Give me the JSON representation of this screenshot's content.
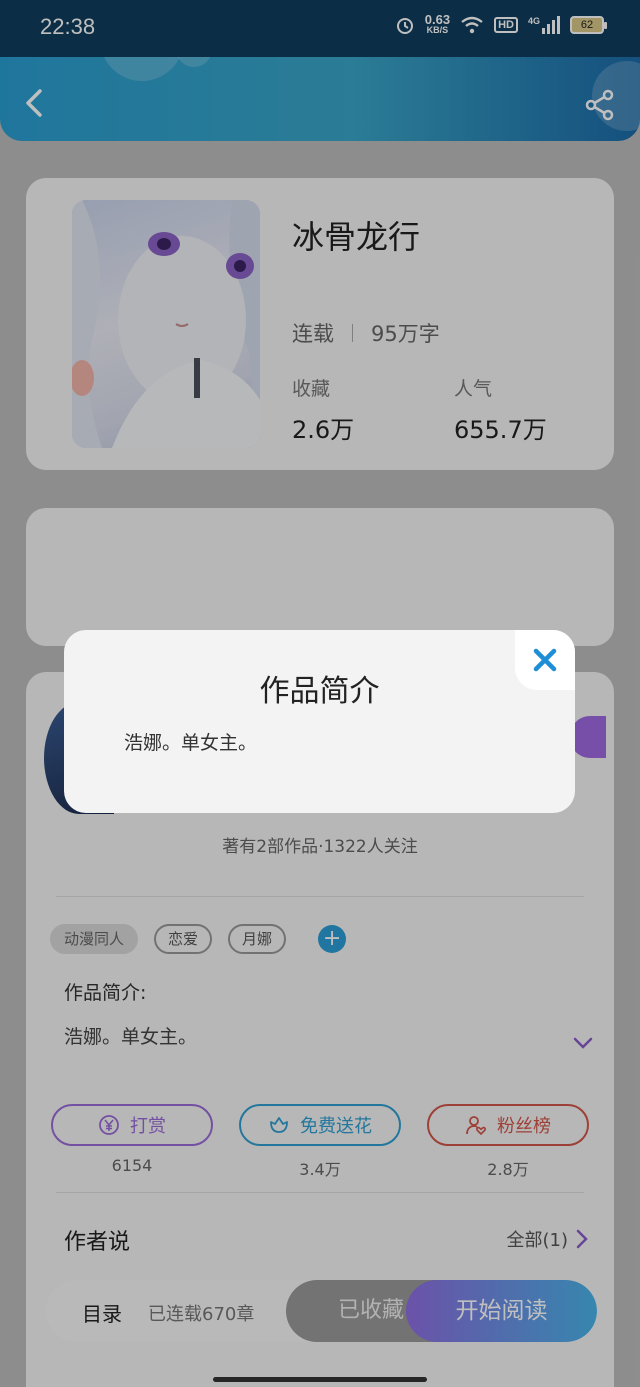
{
  "status_bar": {
    "time": "22:38",
    "net_speed": "0.63",
    "net_unit": "KB/S",
    "hd": "HD",
    "signal": "4G",
    "battery": "62"
  },
  "book": {
    "title": "冰骨龙行",
    "status": "连载",
    "word_count": "95万字",
    "favorites_label": "收藏",
    "favorites_value": "2.6万",
    "popularity_label": "人气",
    "popularity_value": "655.7万"
  },
  "author": {
    "meta": "著有2部作品·1322人关注"
  },
  "tags": [
    "动漫同人",
    "恋爱",
    "月娜"
  ],
  "add_tag_label": "+",
  "intro": {
    "label": "作品简介:",
    "text": "浩娜。单女主。"
  },
  "actions": [
    {
      "label": "打赏",
      "count": "6154",
      "color": "#9b6bd8"
    },
    {
      "label": "免费送花",
      "count": "3.4万",
      "color": "#2f9fd0"
    },
    {
      "label": "粉丝榜",
      "count": "2.8万",
      "color": "#d2564a"
    }
  ],
  "author_says": {
    "label": "作者说",
    "all_link": "全部(1)"
  },
  "bottom_bar": {
    "toc": "目录",
    "serialized": "已连载670章",
    "collected": "已收藏",
    "read": "开始阅读"
  },
  "modal": {
    "title": "作品简介",
    "body": "浩娜。单女主。"
  }
}
